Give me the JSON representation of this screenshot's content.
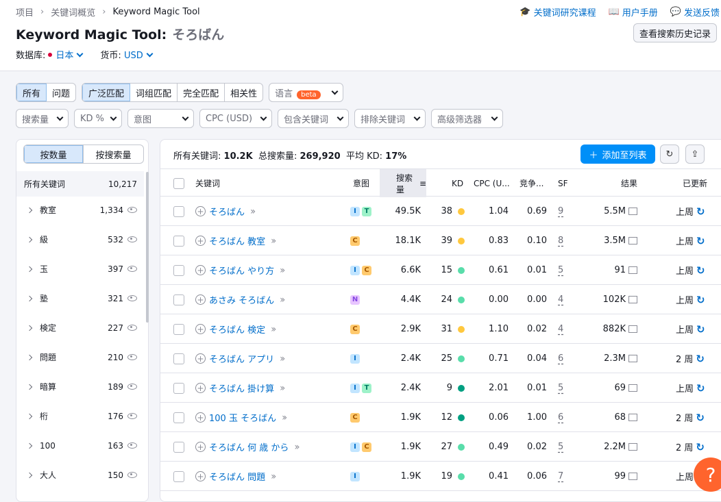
{
  "breadcrumb": [
    "项目",
    "关键词概览",
    "Keyword Magic Tool"
  ],
  "top_links": [
    "关键词研究课程",
    "用户手册",
    "发送反馈"
  ],
  "page_title": "Keyword Magic Tool:",
  "query": "そろばん",
  "history_button": "查看搜索历史记录",
  "database_label": "数据库:",
  "database_value": "日本",
  "currency_label": "货币:",
  "currency_value": "USD",
  "filters_row1": {
    "group1": [
      "所有",
      "问题"
    ],
    "group2": [
      "广泛匹配",
      "词组匹配",
      "完全匹配",
      "相关性"
    ],
    "language": "语言",
    "beta": "beta"
  },
  "filters_row2": [
    "搜索量",
    "KD %",
    "意图",
    "CPC (USD)",
    "包含关键词",
    "排除关键词",
    "高级筛选器"
  ],
  "sidebar": {
    "toggle": [
      "按数量",
      "按搜索量"
    ],
    "all_label": "所有关键词",
    "all_count": "10,217",
    "items": [
      {
        "name": "教室",
        "count": "1,334"
      },
      {
        "name": "級",
        "count": "532"
      },
      {
        "name": "玉",
        "count": "397"
      },
      {
        "name": "塾",
        "count": "321"
      },
      {
        "name": "検定",
        "count": "227"
      },
      {
        "name": "問題",
        "count": "210"
      },
      {
        "name": "暗算",
        "count": "189"
      },
      {
        "name": "桁",
        "count": "176"
      },
      {
        "name": "100",
        "count": "163"
      },
      {
        "name": "大人",
        "count": "150"
      }
    ]
  },
  "stats": {
    "all_label": "所有关键词:",
    "all_value": "10.2K",
    "volume_label": "总搜索量:",
    "volume_value": "269,920",
    "kd_label": "平均 KD:",
    "kd_value": "17%"
  },
  "add_button": "添加至列表",
  "table": {
    "headers": [
      "关键词",
      "意图",
      "搜索量",
      "KD",
      "CPC (U...",
      "竞争...",
      "SF",
      "结果",
      "已更新"
    ],
    "rows": [
      {
        "kw": "そろばん",
        "intent": [
          "I",
          "T"
        ],
        "vol": "49.5K",
        "kd": "38",
        "kdc": "#ffc83e",
        "cpc": "1.04",
        "com": "0.69",
        "sf": "9",
        "res": "5.5M",
        "upd": "上周"
      },
      {
        "kw": "そろばん 教室",
        "intent": [
          "C"
        ],
        "vol": "18.1K",
        "kd": "39",
        "kdc": "#ffc83e",
        "cpc": "0.83",
        "com": "0.10",
        "sf": "8",
        "res": "3.5M",
        "upd": "上周"
      },
      {
        "kw": "そろばん やり方",
        "intent": [
          "I",
          "C"
        ],
        "vol": "6.6K",
        "kd": "15",
        "kdc": "#59ddaa",
        "cpc": "0.61",
        "com": "0.01",
        "sf": "5",
        "res": "91",
        "upd": "上周"
      },
      {
        "kw": "あさみ そろばん",
        "intent": [
          "N"
        ],
        "vol": "4.4K",
        "kd": "24",
        "kdc": "#59ddaa",
        "cpc": "0.00",
        "com": "0.00",
        "sf": "4",
        "res": "102K",
        "upd": "上周"
      },
      {
        "kw": "そろばん 検定",
        "intent": [
          "C"
        ],
        "vol": "2.9K",
        "kd": "31",
        "kdc": "#ffc83e",
        "cpc": "1.10",
        "com": "0.02",
        "sf": "4",
        "res": "882K",
        "upd": "上周"
      },
      {
        "kw": "そろばん アプリ",
        "intent": [
          "I"
        ],
        "vol": "2.4K",
        "kd": "25",
        "kdc": "#59ddaa",
        "cpc": "0.71",
        "com": "0.04",
        "sf": "6",
        "res": "2.3M",
        "upd": "2 周"
      },
      {
        "kw": "そろばん 掛け算",
        "intent": [
          "I",
          "T"
        ],
        "vol": "2.4K",
        "kd": "9",
        "kdc": "#009f81",
        "cpc": "2.01",
        "com": "0.01",
        "sf": "5",
        "res": "69",
        "upd": "上周"
      },
      {
        "kw": "100 玉 そろばん",
        "intent": [
          "C"
        ],
        "vol": "1.9K",
        "kd": "12",
        "kdc": "#009f81",
        "cpc": "0.06",
        "com": "1.00",
        "sf": "6",
        "res": "68",
        "upd": "2 周"
      },
      {
        "kw": "そろばん 何 歳 から",
        "intent": [
          "I",
          "C"
        ],
        "vol": "1.9K",
        "kd": "27",
        "kdc": "#59ddaa",
        "cpc": "0.49",
        "com": "0.02",
        "sf": "5",
        "res": "2.2M",
        "upd": "2 周"
      },
      {
        "kw": "そろばん 問題",
        "intent": [
          "I"
        ],
        "vol": "1.9K",
        "kd": "19",
        "kdc": "#59ddaa",
        "cpc": "0.41",
        "com": "0.06",
        "sf": "7",
        "res": "99",
        "upd": "上周"
      }
    ]
  },
  "help_label": "?"
}
